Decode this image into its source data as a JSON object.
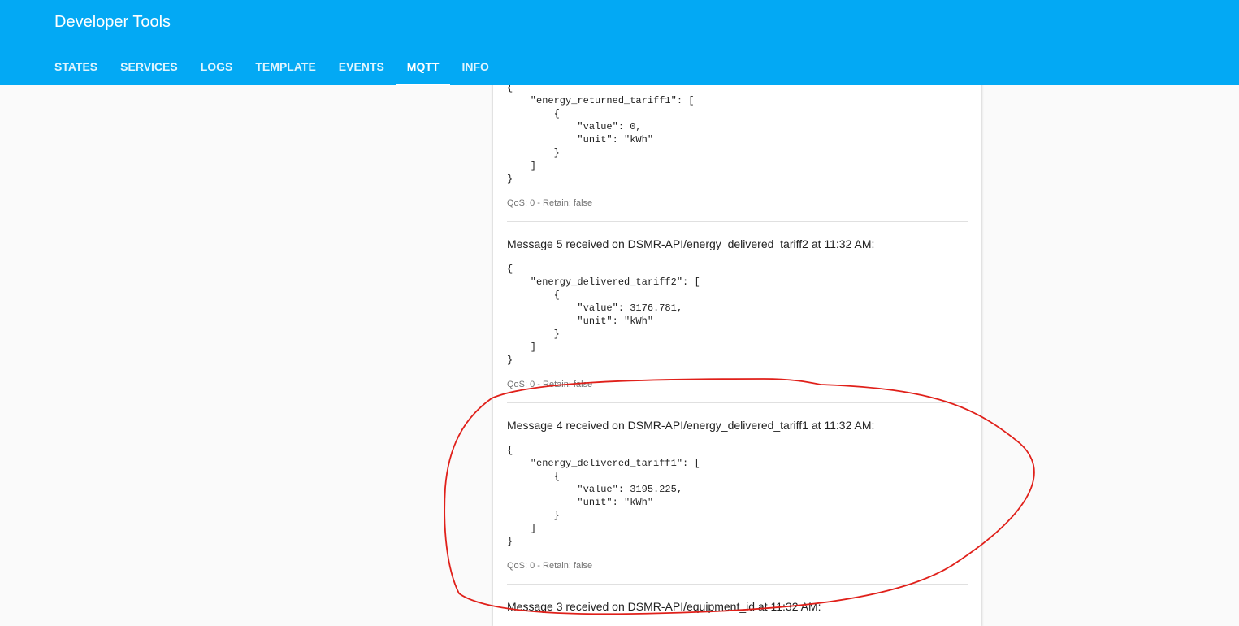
{
  "header": {
    "title": "Developer Tools",
    "tabs": [
      {
        "label": "STATES"
      },
      {
        "label": "SERVICES"
      },
      {
        "label": "LOGS"
      },
      {
        "label": "TEMPLATE"
      },
      {
        "label": "EVENTS"
      },
      {
        "label": "MQTT",
        "active": true
      },
      {
        "label": "INFO"
      }
    ]
  },
  "messages": [
    {
      "title": "",
      "payload": "{\n    \"energy_returned_tariff1\": [\n        {\n            \"value\": 0,\n            \"unit\": \"kWh\"\n        }\n    ]\n}",
      "qos": "QoS: 0 - Retain: false"
    },
    {
      "title": "Message 5 received on DSMR-API/energy_delivered_tariff2 at 11:32 AM:",
      "payload": "{\n    \"energy_delivered_tariff2\": [\n        {\n            \"value\": 3176.781,\n            \"unit\": \"kWh\"\n        }\n    ]\n}",
      "qos": "QoS: 0 - Retain: false"
    },
    {
      "title": "Message 4 received on DSMR-API/energy_delivered_tariff1 at 11:32 AM:",
      "payload": "{\n    \"energy_delivered_tariff1\": [\n        {\n            \"value\": 3195.225,\n            \"unit\": \"kWh\"\n        }\n    ]\n}",
      "qos": "QoS: 0 - Retain: false"
    },
    {
      "title": "Message 3 received on DSMR-API/equipment_id at 11:32 AM:"
    }
  ],
  "annotation": {
    "color": "#e0201a",
    "shape": "hand-drawn-circle"
  },
  "colors": {
    "header": "#03a9f4",
    "background": "#fafafa",
    "card": "#ffffff"
  }
}
